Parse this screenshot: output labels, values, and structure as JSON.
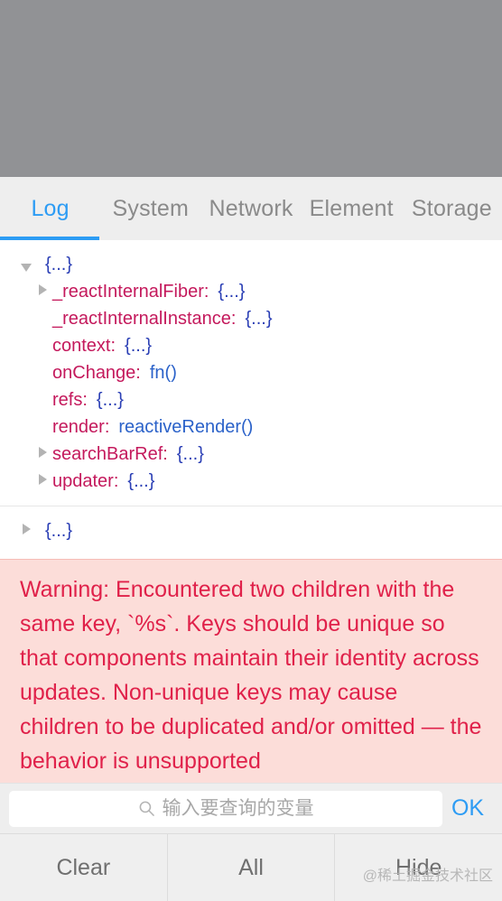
{
  "overlay": {
    "label": "dimmed-page-area"
  },
  "tabs": [
    {
      "label": "Log",
      "active": true
    },
    {
      "label": "System",
      "active": false
    },
    {
      "label": "Network",
      "active": false
    },
    {
      "label": "Element",
      "active": false
    },
    {
      "label": "Storage",
      "active": false
    }
  ],
  "colors": {
    "accent": "#2d9cf4",
    "property_name": "#c4195c",
    "property_value": "#2b3fb5",
    "warning_text": "#e0214a",
    "warning_background": "#fcddd9",
    "overlay_gray": "#919295",
    "chrome_gray": "#eeeeee"
  },
  "log": {
    "groups": [
      {
        "rows": [
          {
            "arrow": "down",
            "indent": 0,
            "key": "",
            "value": "{...}"
          },
          {
            "arrow": "right",
            "indent": 1,
            "key": "_reactInternalFiber:",
            "value": "{...}"
          },
          {
            "arrow": "none",
            "indent": 1,
            "key": "_reactInternalInstance:",
            "value": "{...}"
          },
          {
            "arrow": "none",
            "indent": 1,
            "key": "context:",
            "value": "{...}"
          },
          {
            "arrow": "none",
            "indent": 1,
            "key": "onChange:",
            "value": "fn()"
          },
          {
            "arrow": "none",
            "indent": 1,
            "key": "refs:",
            "value": "{...}"
          },
          {
            "arrow": "none",
            "indent": 1,
            "key": "render:",
            "value": "reactiveRender()"
          },
          {
            "arrow": "right",
            "indent": 1,
            "key": "searchBarRef:",
            "value": "{...}"
          },
          {
            "arrow": "right",
            "indent": 1,
            "key": "updater:",
            "value": "{...}"
          }
        ]
      },
      {
        "rows": [
          {
            "arrow": "right",
            "indent": 0,
            "key": "",
            "value": "{...}"
          }
        ]
      }
    ]
  },
  "warning": {
    "text": "Warning: Encountered two children with the same key, `%s`. Keys should be unique so that components maintain their identity across updates. Non-unique keys may cause children to be duplicated and/or omitted — the behavior is unsupported"
  },
  "search": {
    "placeholder": "输入要查询的变量",
    "value": "",
    "icon": "search-icon",
    "confirm_label": "OK"
  },
  "toolbar": {
    "buttons": [
      {
        "label": "Clear"
      },
      {
        "label": "All"
      },
      {
        "label": "Hide"
      }
    ]
  },
  "watermark": {
    "text": "@稀土掘金技术社区"
  }
}
